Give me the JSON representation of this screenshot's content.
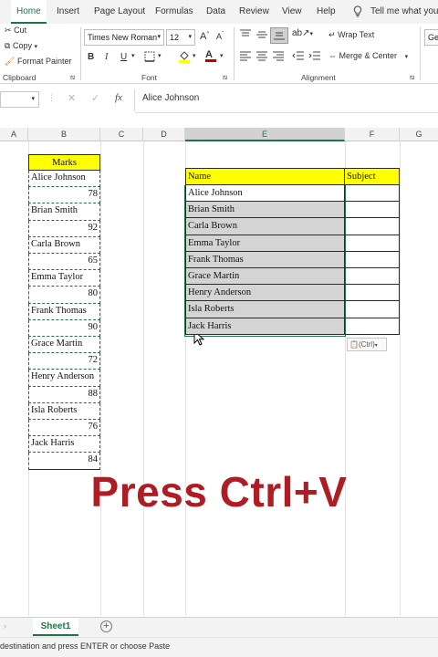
{
  "ribbon_tabs": [
    "Home",
    "Insert",
    "Page Layout",
    "Formulas",
    "Data",
    "Review",
    "View",
    "Help"
  ],
  "tell_me": "Tell me what you w",
  "clipboard": {
    "cut": "Cut",
    "copy": "Copy",
    "format_painter": "Format Painter",
    "group_label": "Clipboard"
  },
  "font": {
    "name": "Times New Roman",
    "size": "12",
    "grow": "A",
    "shrink": "A",
    "bold": "B",
    "italic": "I",
    "underline": "U",
    "font_color_letter": "A",
    "group_label": "Font",
    "accent_color": "#c00000",
    "fill_color": "#ffff00"
  },
  "alignment": {
    "wrap_text": "Wrap Text",
    "merge_center": "Merge & Center",
    "group_label": "Alignment"
  },
  "number": {
    "format_fragment": "Ger"
  },
  "formula_bar": {
    "fx": "fx",
    "value": "Alice Johnson"
  },
  "columns": [
    "A",
    "B",
    "C",
    "D",
    "E",
    "F",
    "G"
  ],
  "marks_table": {
    "header": "Marks",
    "rows": [
      {
        "name": "Alice Johnson",
        "mark": "78"
      },
      {
        "name": "Brian Smith",
        "mark": "92"
      },
      {
        "name": "Carla Brown",
        "mark": "65"
      },
      {
        "name": "Emma Taylor",
        "mark": "80"
      },
      {
        "name": "Frank Thomas",
        "mark": "90"
      },
      {
        "name": "Grace Martin",
        "mark": "72"
      },
      {
        "name": "Henry Anderson",
        "mark": "88"
      },
      {
        "name": "Isla Roberts",
        "mark": "76"
      },
      {
        "name": "Jack Harris",
        "mark": "84"
      }
    ]
  },
  "pasted_table": {
    "name_header": "Name",
    "subject_header": "Subject",
    "names": [
      "Alice Johnson",
      "Brian Smith",
      "Carla Brown",
      "Emma Taylor",
      "Frank Thomas",
      "Grace Martin",
      "Henry Anderson",
      "Isla Roberts",
      "Jack Harris"
    ]
  },
  "paste_options": "(Ctrl)",
  "overlay_text": "Press Ctrl+V",
  "sheet_tab": "Sheet1",
  "add_sheet": "+",
  "status_text": "destination and press ENTER or choose Paste",
  "colors": {
    "excel_green": "#217346",
    "header_yellow": "#ffff00",
    "selection_gray": "#d4d4d4",
    "overlay_red": "#b01c24"
  }
}
